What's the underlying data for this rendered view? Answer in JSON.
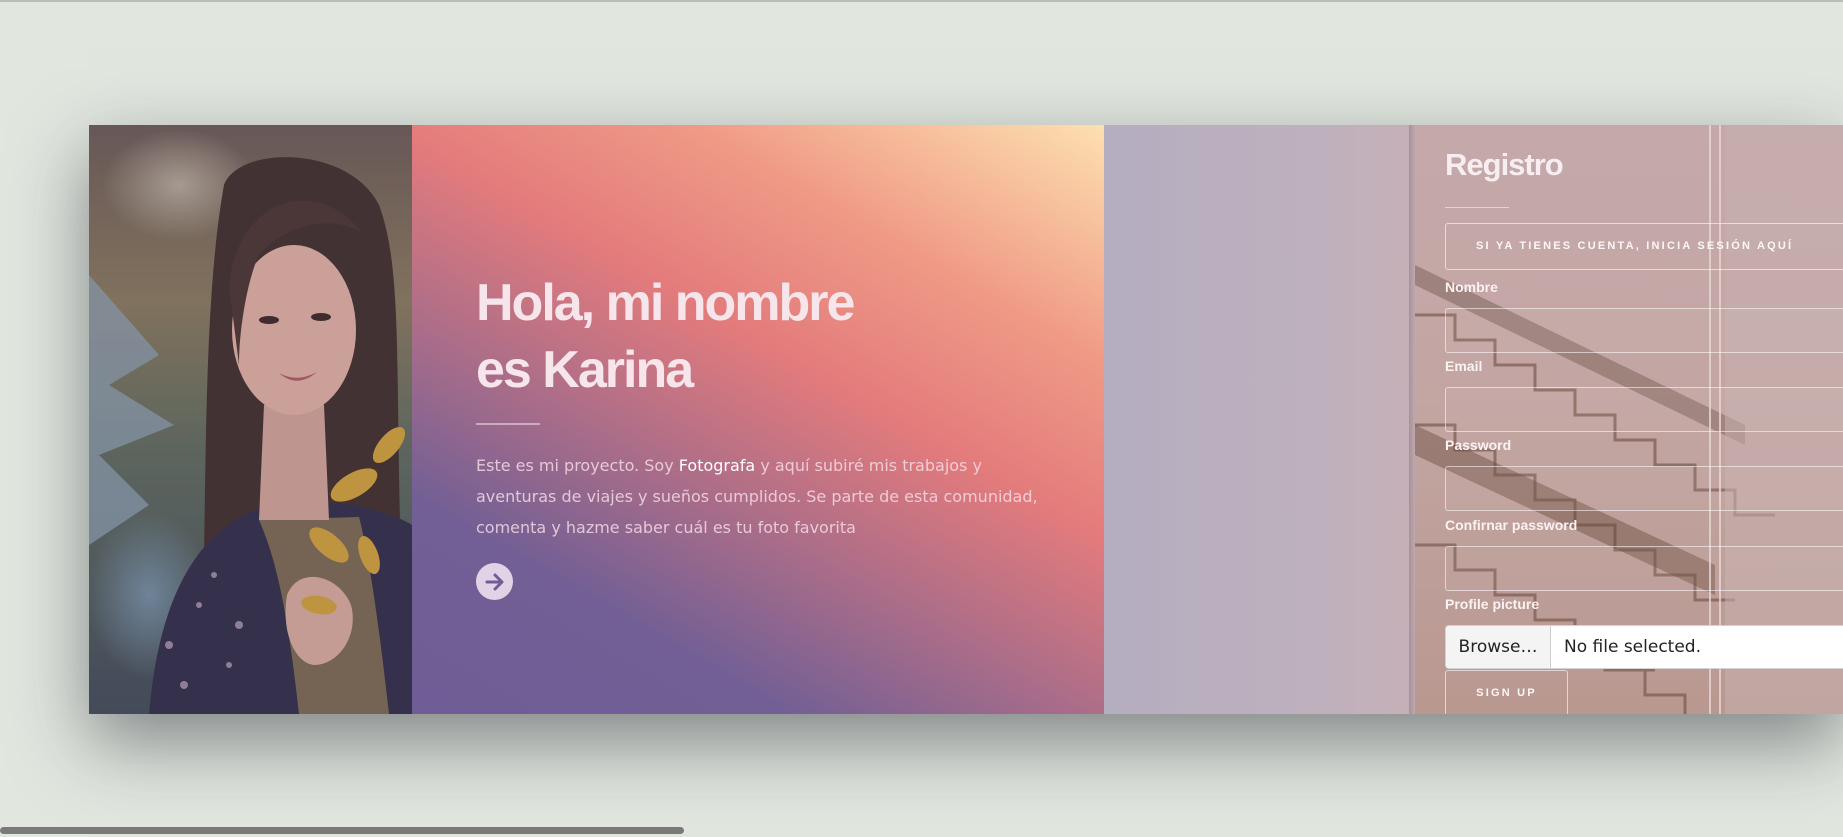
{
  "hero": {
    "title_line1": "Hola, mi nombre",
    "title_line2": "es Karina",
    "desc_before": "Este es mi proyecto. Soy ",
    "desc_highlight": "Fotografa",
    "desc_after": " y aquí subiré mis trabajos y aventuras de viajes y sueños cumplidos. Se parte de esta comunidad, comenta y hazme saber cuál es tu foto favorita",
    "arrow_icon": "arrow-right-circle-icon"
  },
  "form": {
    "title": "Registro",
    "login_link": "SI YA TIENES CUENTA, INICIA SESIÓN AQUÍ",
    "fields": {
      "name_label": "Nombre",
      "email_label": "Email",
      "password_label": "Password",
      "confirm_label": "Confirnar password",
      "picture_label": "Profile picture"
    },
    "file": {
      "browse_label": "Browse…",
      "status": "No file selected."
    },
    "signup_label": "SIGN UP"
  },
  "colors": {
    "page_bg": "#e1e6df",
    "gradient_start": "#6e5d96",
    "gradient_mid": "#e37b7c",
    "gradient_end": "#fde0b0"
  }
}
